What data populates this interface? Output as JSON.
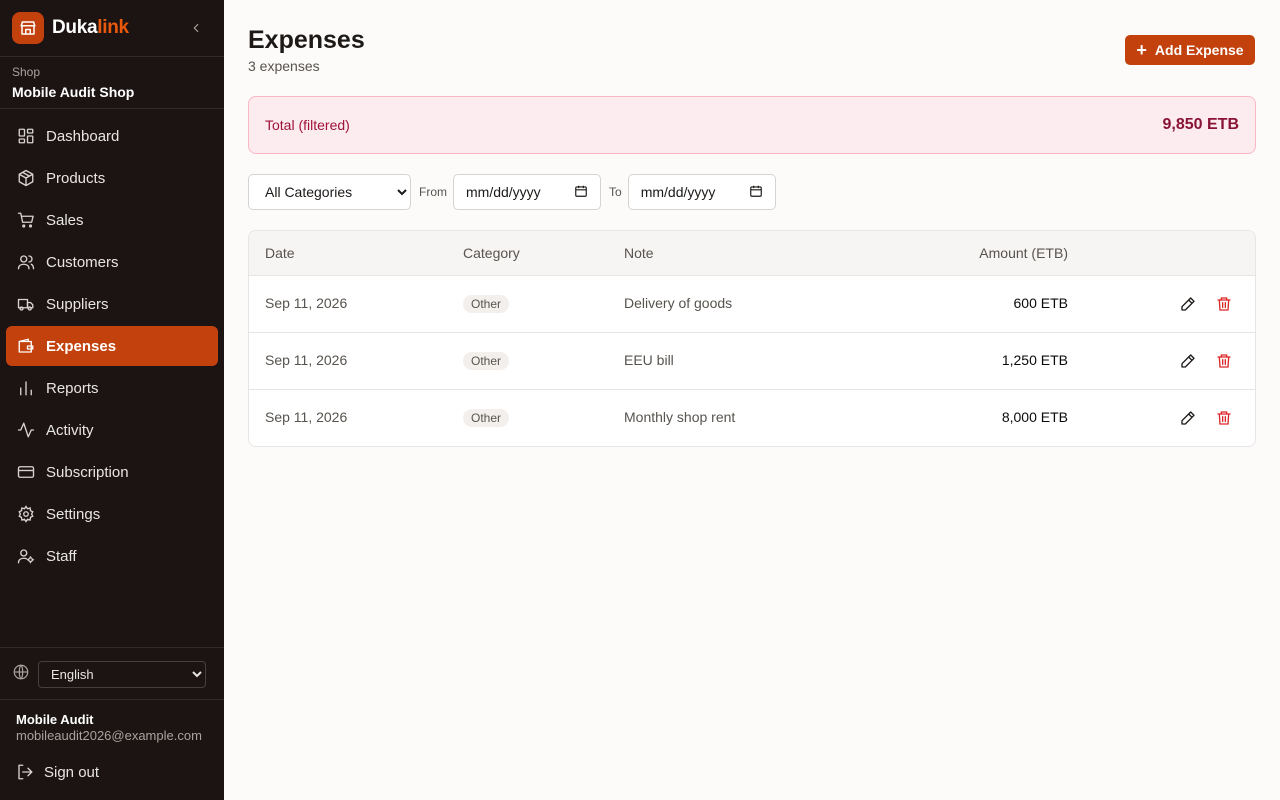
{
  "brand": {
    "name_part1": "Duka",
    "name_part2": "link"
  },
  "shop": {
    "label": "Shop",
    "name": "Mobile Audit Shop"
  },
  "nav": [
    {
      "label": "Dashboard",
      "icon": "dashboard-icon",
      "active": false
    },
    {
      "label": "Products",
      "icon": "package-icon",
      "active": false
    },
    {
      "label": "Sales",
      "icon": "cart-icon",
      "active": false
    },
    {
      "label": "Customers",
      "icon": "users-icon",
      "active": false
    },
    {
      "label": "Suppliers",
      "icon": "truck-icon",
      "active": false
    },
    {
      "label": "Expenses",
      "icon": "wallet-icon",
      "active": true
    },
    {
      "label": "Reports",
      "icon": "bar-chart-icon",
      "active": false
    },
    {
      "label": "Activity",
      "icon": "activity-icon",
      "active": false
    },
    {
      "label": "Subscription",
      "icon": "credit-card-icon",
      "active": false
    },
    {
      "label": "Settings",
      "icon": "gear-icon",
      "active": false
    },
    {
      "label": "Staff",
      "icon": "user-cog-icon",
      "active": false
    }
  ],
  "language": {
    "selected": "English"
  },
  "user": {
    "name": "Mobile Audit",
    "email": "mobileaudit2026@example.com"
  },
  "signout_label": "Sign out",
  "page": {
    "title": "Expenses",
    "subtitle": "3 expenses",
    "add_button": "Add Expense"
  },
  "total": {
    "label": "Total (filtered)",
    "value": "9,850 ETB"
  },
  "filters": {
    "category_selected": "All Categories",
    "from_label": "From",
    "from_placeholder": "mm/dd/yyyy",
    "to_label": "To",
    "to_placeholder": "mm/dd/yyyy"
  },
  "table": {
    "headers": {
      "date": "Date",
      "category": "Category",
      "note": "Note",
      "amount": "Amount (ETB)"
    },
    "rows": [
      {
        "date": "Sep 11, 2026",
        "category": "Other",
        "note": "Delivery of goods",
        "amount": "600 ETB"
      },
      {
        "date": "Sep 11, 2026",
        "category": "Other",
        "note": "EEU bill",
        "amount": "1,250 ETB"
      },
      {
        "date": "Sep 11, 2026",
        "category": "Other",
        "note": "Monthly shop rent",
        "amount": "8,000 ETB"
      }
    ]
  },
  "colors": {
    "sidebar_bg": "#1c1413",
    "accent": "#c2410c",
    "total_bg": "#fdecef",
    "delete_red": "#dc2626"
  }
}
